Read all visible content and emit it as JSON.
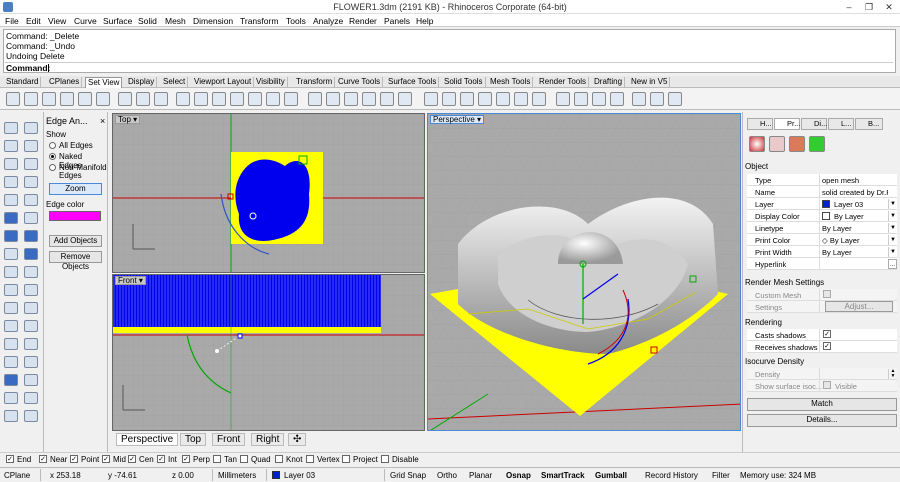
{
  "window": {
    "title": "FLOWER1.3dm (2191 KB) - Rhinoceros Corporate (64-bit)",
    "minimize": "–",
    "restore": "❐",
    "close": "✕"
  },
  "menu": [
    "File",
    "Edit",
    "View",
    "Curve",
    "Surface",
    "Solid",
    "Mesh",
    "Dimension",
    "Transform",
    "Tools",
    "Analyze",
    "Render",
    "Panels",
    "Help"
  ],
  "command": {
    "history": [
      "Command: _Delete",
      "Command: _Undo",
      "Undoing Delete"
    ],
    "prompt": "Command:"
  },
  "toolbar_tabs": [
    {
      "label": "Standard",
      "active": false
    },
    {
      "label": "CPlanes",
      "active": false
    },
    {
      "label": "Set View",
      "active": true
    },
    {
      "label": "Display",
      "active": false
    },
    {
      "label": "Select",
      "active": false
    },
    {
      "label": "Viewport Layout",
      "active": false
    },
    {
      "label": "Visibility",
      "active": false
    },
    {
      "label": "Transform",
      "active": false
    },
    {
      "label": "Curve Tools",
      "active": false
    },
    {
      "label": "Surface Tools",
      "active": false
    },
    {
      "label": "Solid Tools",
      "active": false
    },
    {
      "label": "Mesh Tools",
      "active": false
    },
    {
      "label": "Render Tools",
      "active": false
    },
    {
      "label": "Drafting",
      "active": false
    },
    {
      "label": "New in V5",
      "active": false
    }
  ],
  "edge_panel": {
    "title": "Edge An...",
    "close": "×",
    "show_label": "Show",
    "options": [
      {
        "label": "All Edges",
        "selected": false
      },
      {
        "label": "Naked Edges",
        "selected": true
      },
      {
        "label": "Non-Manifold",
        "selected": false
      }
    ],
    "option_cont": "Edges",
    "zoom": "Zoom",
    "edge_color_label": "Edge color",
    "edge_color": "#ff00ff",
    "add_objects": "Add Objects",
    "remove_objects": "Remove Objects"
  },
  "viewports": {
    "top": "Top",
    "front": "Front",
    "perspective": "Perspective",
    "arrow": "▾"
  },
  "viewport_tabs": [
    {
      "label": "Perspective",
      "active": true
    },
    {
      "label": "Top",
      "active": false
    },
    {
      "label": "Front",
      "active": false
    },
    {
      "label": "Right",
      "active": false
    },
    {
      "label": "✣",
      "active": false
    }
  ],
  "props": {
    "tabs": [
      "H...",
      "Pr...",
      "Di...",
      "L...",
      "B..."
    ],
    "object_heading": "Object",
    "rows": [
      {
        "k": "Type",
        "v": "open mesh",
        "dd": false
      },
      {
        "k": "Name",
        "v": "solid created by Dr.P...",
        "dd": false
      },
      {
        "k": "Layer",
        "v": "Layer 03",
        "dd": true,
        "swatch": "#0022cc"
      },
      {
        "k": "Display Color",
        "v": "By Layer",
        "dd": true,
        "swatch": "#ffffff"
      },
      {
        "k": "Linetype",
        "v": "By Layer",
        "dd": true
      },
      {
        "k": "Print Color",
        "v": "◇ By Layer",
        "dd": true
      },
      {
        "k": "Print Width",
        "v": "By Layer",
        "dd": true
      },
      {
        "k": "Hyperlink",
        "v": "",
        "dd": false,
        "more": "..."
      }
    ],
    "render_mesh_heading": "Render Mesh Settings",
    "custom_mesh": "Custom Mesh",
    "settings": "Settings",
    "adjust": "Adjust...",
    "rendering_heading": "Rendering",
    "casts_shadows": "Casts shadows",
    "receives_shadows": "Receives shadows",
    "isocurve_heading": "Isocurve Density",
    "density": "Density",
    "show_surface_iso": "Show surface isoc...",
    "visible": "Visible",
    "match": "Match",
    "details": "Details..."
  },
  "osnaps": [
    {
      "label": "End",
      "on": true
    },
    {
      "label": "Near",
      "on": true
    },
    {
      "label": "Point",
      "on": true
    },
    {
      "label": "Mid",
      "on": true
    },
    {
      "label": "Cen",
      "on": true
    },
    {
      "label": "Int",
      "on": true
    },
    {
      "label": "Perp",
      "on": true
    },
    {
      "label": "Tan",
      "on": false
    },
    {
      "label": "Quad",
      "on": false
    },
    {
      "label": "Knot",
      "on": false
    },
    {
      "label": "Vertex",
      "on": false
    },
    {
      "label": "Project",
      "on": false
    },
    {
      "label": "Disable",
      "on": false
    }
  ],
  "status": {
    "cplane": "CPlane",
    "x": "x 253.18",
    "y": "y -74.61",
    "z": "z 0.00",
    "units": "Millimeters",
    "layer": "Layer 03",
    "layer_color": "#0022cc",
    "grid_snap": "Grid Snap",
    "ortho": "Ortho",
    "planar": "Planar",
    "osnap": "Osnap",
    "smarttrack": "SmartTrack",
    "gumball": "Gumball",
    "record_history": "Record History",
    "filter": "Filter",
    "memory": "Memory use: 324 MB"
  },
  "colors": {
    "mesh_yellow": "#ffff00",
    "mesh_blue": "#0000ee",
    "axis_red": "#cc0000",
    "axis_green": "#00aa00",
    "viewport_bg": "#a9a9a9"
  }
}
